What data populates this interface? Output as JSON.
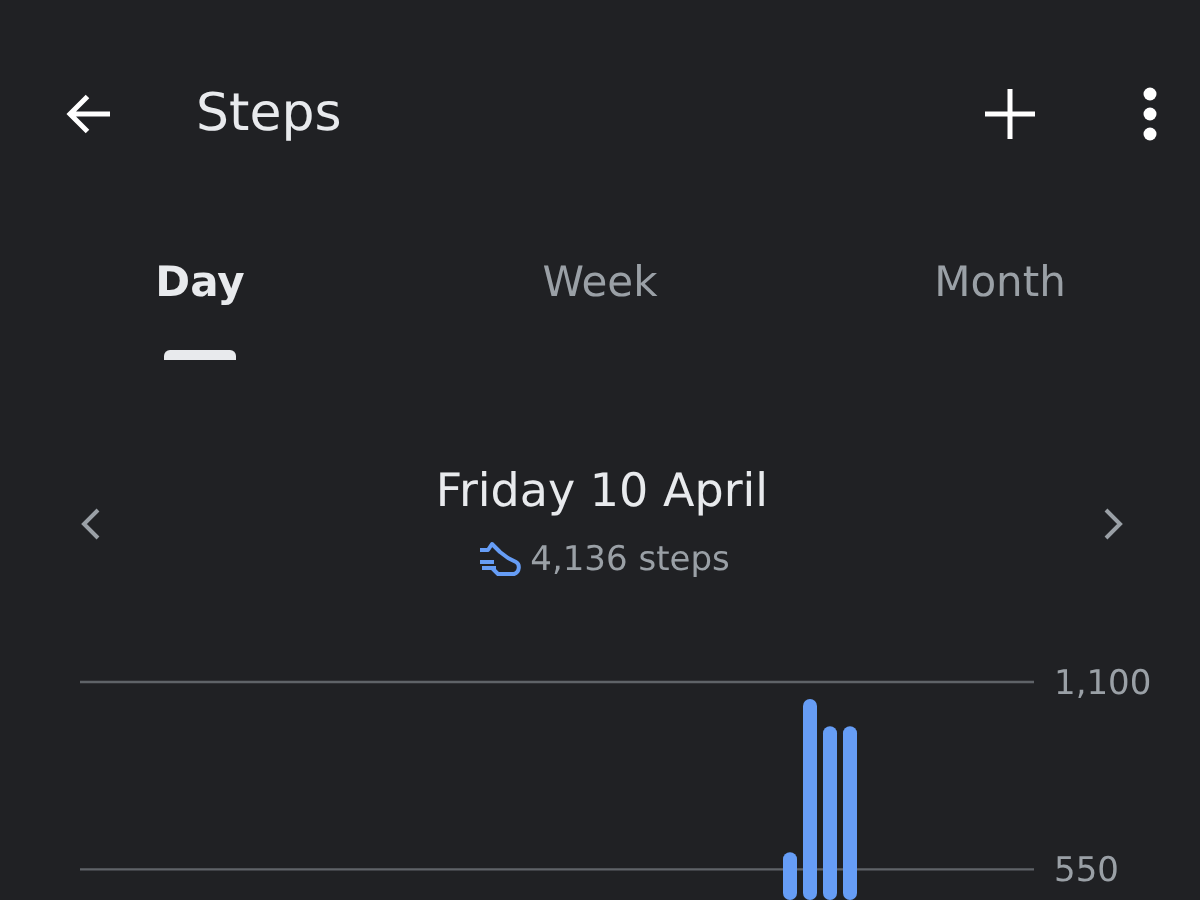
{
  "app_bar": {
    "title": "Steps"
  },
  "tabs": [
    {
      "label": "Day",
      "selected": true
    },
    {
      "label": "Week",
      "selected": false
    },
    {
      "label": "Month",
      "selected": false
    }
  ],
  "day": {
    "date": "Friday 10 April",
    "steps": "4,136 steps"
  },
  "chart": {
    "chart_data": {
      "type": "bar",
      "values": [
        null,
        null,
        null,
        null,
        null,
        null,
        null,
        null,
        null,
        null,
        null,
        null,
        null,
        null,
        null,
        null,
        null,
        null,
        null,
        null,
        null,
        null,
        null,
        null,
        null,
        null,
        null,
        null,
        null,
        null,
        null,
        null,
        null,
        null,
        null,
        600,
        1050,
        970,
        970,
        null,
        null,
        null,
        null,
        null,
        null,
        null,
        null,
        null
      ],
      "ylim": [
        460,
        1100
      ],
      "yticks": [
        {
          "value": 550,
          "label": "550"
        },
        {
          "value": 1100,
          "label": "1,100"
        }
      ]
    }
  }
}
